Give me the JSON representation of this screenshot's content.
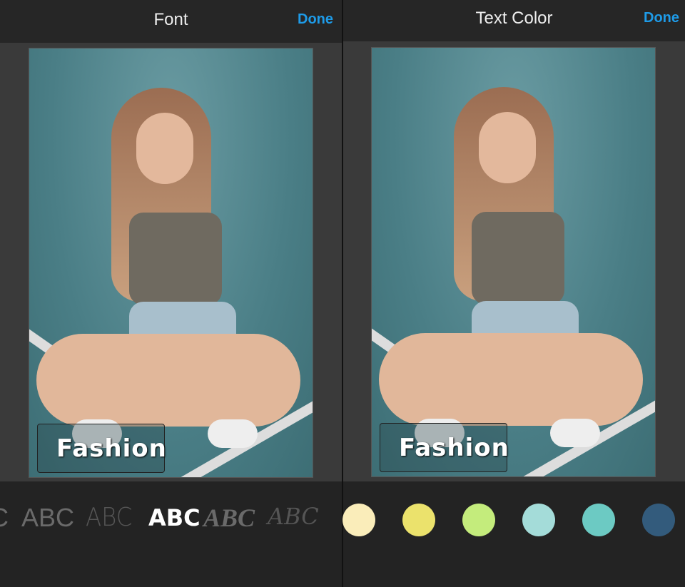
{
  "left": {
    "title": "Font",
    "done": "Done",
    "overlay_text": "Fashion",
    "fonts": [
      {
        "label": "C"
      },
      {
        "label": "ABC"
      },
      {
        "label": "ABC"
      },
      {
        "label": "ABC",
        "selected": true
      },
      {
        "label": "ABC"
      },
      {
        "label": "ABC"
      }
    ]
  },
  "right": {
    "title": "Text Color",
    "done": "Done",
    "overlay_text": "Fashion",
    "colors": [
      "#faedba",
      "#ebe26c",
      "#c4ec7c",
      "#a4dcd9",
      "#6ccac3",
      "#335b7c"
    ]
  }
}
